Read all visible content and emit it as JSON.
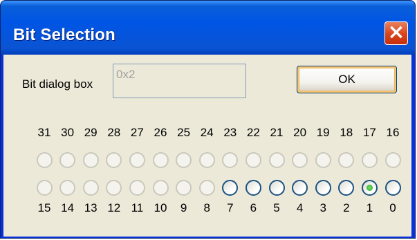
{
  "window": {
    "title": "Bit Selection",
    "close_label": "×"
  },
  "dialog": {
    "label": "Bit dialog box",
    "value": "0x2",
    "ok_label": "OK"
  },
  "high_bits": [
    {
      "num": "31",
      "enabled": false,
      "checked": false
    },
    {
      "num": "30",
      "enabled": false,
      "checked": false
    },
    {
      "num": "29",
      "enabled": false,
      "checked": false
    },
    {
      "num": "28",
      "enabled": false,
      "checked": false
    },
    {
      "num": "27",
      "enabled": false,
      "checked": false
    },
    {
      "num": "26",
      "enabled": false,
      "checked": false
    },
    {
      "num": "25",
      "enabled": false,
      "checked": false
    },
    {
      "num": "24",
      "enabled": false,
      "checked": false
    },
    {
      "num": "23",
      "enabled": false,
      "checked": false
    },
    {
      "num": "22",
      "enabled": false,
      "checked": false
    },
    {
      "num": "21",
      "enabled": false,
      "checked": false
    },
    {
      "num": "20",
      "enabled": false,
      "checked": false
    },
    {
      "num": "19",
      "enabled": false,
      "checked": false
    },
    {
      "num": "18",
      "enabled": false,
      "checked": false
    },
    {
      "num": "17",
      "enabled": false,
      "checked": false
    },
    {
      "num": "16",
      "enabled": false,
      "checked": false
    }
  ],
  "low_bits": [
    {
      "num": "15",
      "enabled": false,
      "checked": false
    },
    {
      "num": "14",
      "enabled": false,
      "checked": false
    },
    {
      "num": "13",
      "enabled": false,
      "checked": false
    },
    {
      "num": "12",
      "enabled": false,
      "checked": false
    },
    {
      "num": "11",
      "enabled": false,
      "checked": false
    },
    {
      "num": "10",
      "enabled": false,
      "checked": false
    },
    {
      "num": "9",
      "enabled": false,
      "checked": false
    },
    {
      "num": "8",
      "enabled": false,
      "checked": false
    },
    {
      "num": "7",
      "enabled": true,
      "checked": false
    },
    {
      "num": "6",
      "enabled": true,
      "checked": false
    },
    {
      "num": "5",
      "enabled": true,
      "checked": false
    },
    {
      "num": "4",
      "enabled": true,
      "checked": false
    },
    {
      "num": "3",
      "enabled": true,
      "checked": false
    },
    {
      "num": "2",
      "enabled": true,
      "checked": false
    },
    {
      "num": "1",
      "enabled": true,
      "checked": true
    },
    {
      "num": "0",
      "enabled": true,
      "checked": false
    }
  ]
}
